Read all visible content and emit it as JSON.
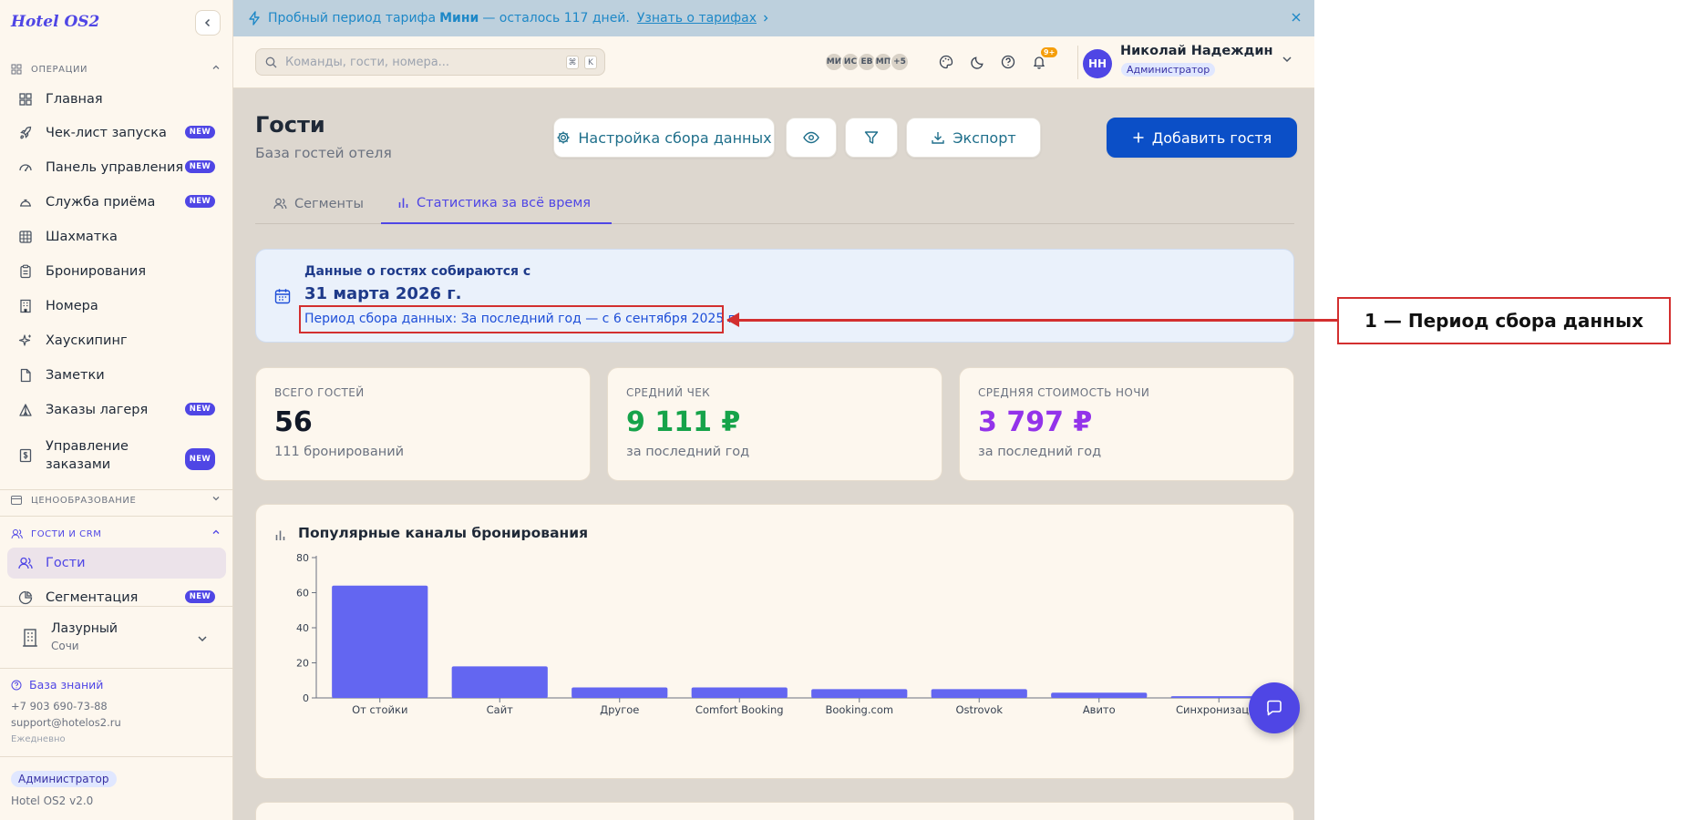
{
  "sidebar": {
    "logo": "Hotel OS2",
    "sections": {
      "operations": "ОПЕРАЦИИ",
      "pricing": "ЦЕНООБРАЗОВАНИЕ",
      "crm": "ГОСТИ И CRM"
    },
    "items": [
      {
        "label": "Главная",
        "icon": "grid-icon"
      },
      {
        "label": "Чек-лист запуска",
        "icon": "rocket-icon",
        "badge": "NEW"
      },
      {
        "label": "Панель управления",
        "icon": "gauge-icon",
        "badge": "NEW"
      },
      {
        "label": "Служба приёма",
        "icon": "bell-desk-icon",
        "badge": "NEW"
      },
      {
        "label": "Шахматка",
        "icon": "table-icon"
      },
      {
        "label": "Бронирования",
        "icon": "clipboard-icon"
      },
      {
        "label": "Номера",
        "icon": "building-icon"
      },
      {
        "label": "Хаускипинг",
        "icon": "sparkles-icon"
      },
      {
        "label": "Заметки",
        "icon": "note-icon"
      },
      {
        "label": "Заказы лагеря",
        "icon": "tent-icon",
        "badge": "NEW"
      },
      {
        "label": "Управление заказами",
        "icon": "receipt-icon",
        "badge": "NEW"
      }
    ],
    "crm_items": [
      {
        "label": "Гости",
        "icon": "users-icon",
        "active": true
      },
      {
        "label": "Сегментация",
        "icon": "pie-icon",
        "badge": "NEW"
      }
    ],
    "hotel": {
      "name": "Лазурный",
      "city": "Сочи"
    },
    "footer": {
      "kb": "База знаний",
      "phone": "+7 903 690-73-88",
      "email": "support@hotelos2.ru",
      "schedule": "Ежедневно",
      "role": "Администратор",
      "version": "Hotel OS2 v2.0"
    }
  },
  "banner": {
    "text_before": "Пробный период тарифа",
    "plan": "Мини",
    "text_after": "— осталось 117 дней.",
    "link": "Узнать о тарифах"
  },
  "topbar": {
    "search_placeholder": "Команды, гости, номера...",
    "kbd1": "⌘",
    "kbd2": "K",
    "avatars": [
      "МИ",
      "ИС",
      "ЕВ",
      "МП",
      "+5"
    ],
    "notif_count": "9+",
    "user_initials": "НН",
    "user_name": "Николай Надеждин",
    "user_role": "Администратор"
  },
  "page": {
    "title": "Гости",
    "subtitle": "База гостей отеля",
    "buttons": {
      "settings": "Настройка сбора данных",
      "export": "Экспорт",
      "add": "Добавить гостя"
    },
    "tabs": [
      "Сегменты",
      "Статистика за всё время"
    ]
  },
  "info": {
    "line1": "Данные о гостях собираются с",
    "line2": "31 марта 2026 г.",
    "line3": "Период сбора данных: За последний год — с 6 сентября 2025 г."
  },
  "stats": [
    {
      "label": "ВСЕГО ГОСТЕЙ",
      "value": "56",
      "sub": "111 бронирований",
      "color": "#111827"
    },
    {
      "label": "СРЕДНИЙ ЧЕК",
      "value": "9 111 ₽",
      "sub": "за последний год",
      "color": "#16a34a"
    },
    {
      "label": "СРЕДНЯЯ СТОИМОСТЬ НОЧИ",
      "value": "3 797 ₽",
      "sub": "за последний год",
      "color": "#9333ea"
    }
  ],
  "chart_title": "Популярные каналы бронирования",
  "chart_data": {
    "type": "bar",
    "categories": [
      "От стойки",
      "Сайт",
      "Другое",
      "Comfort Booking",
      "Booking.com",
      "Ostrovok",
      "Авито",
      "Синхронизация"
    ],
    "values": [
      64,
      18,
      6,
      6,
      5,
      5,
      3,
      1
    ],
    "yticks": [
      0,
      20,
      40,
      60,
      80
    ],
    "ylim": [
      0,
      80
    ],
    "color": "#6366f1"
  },
  "annotation": "1 — Период сбора данных"
}
